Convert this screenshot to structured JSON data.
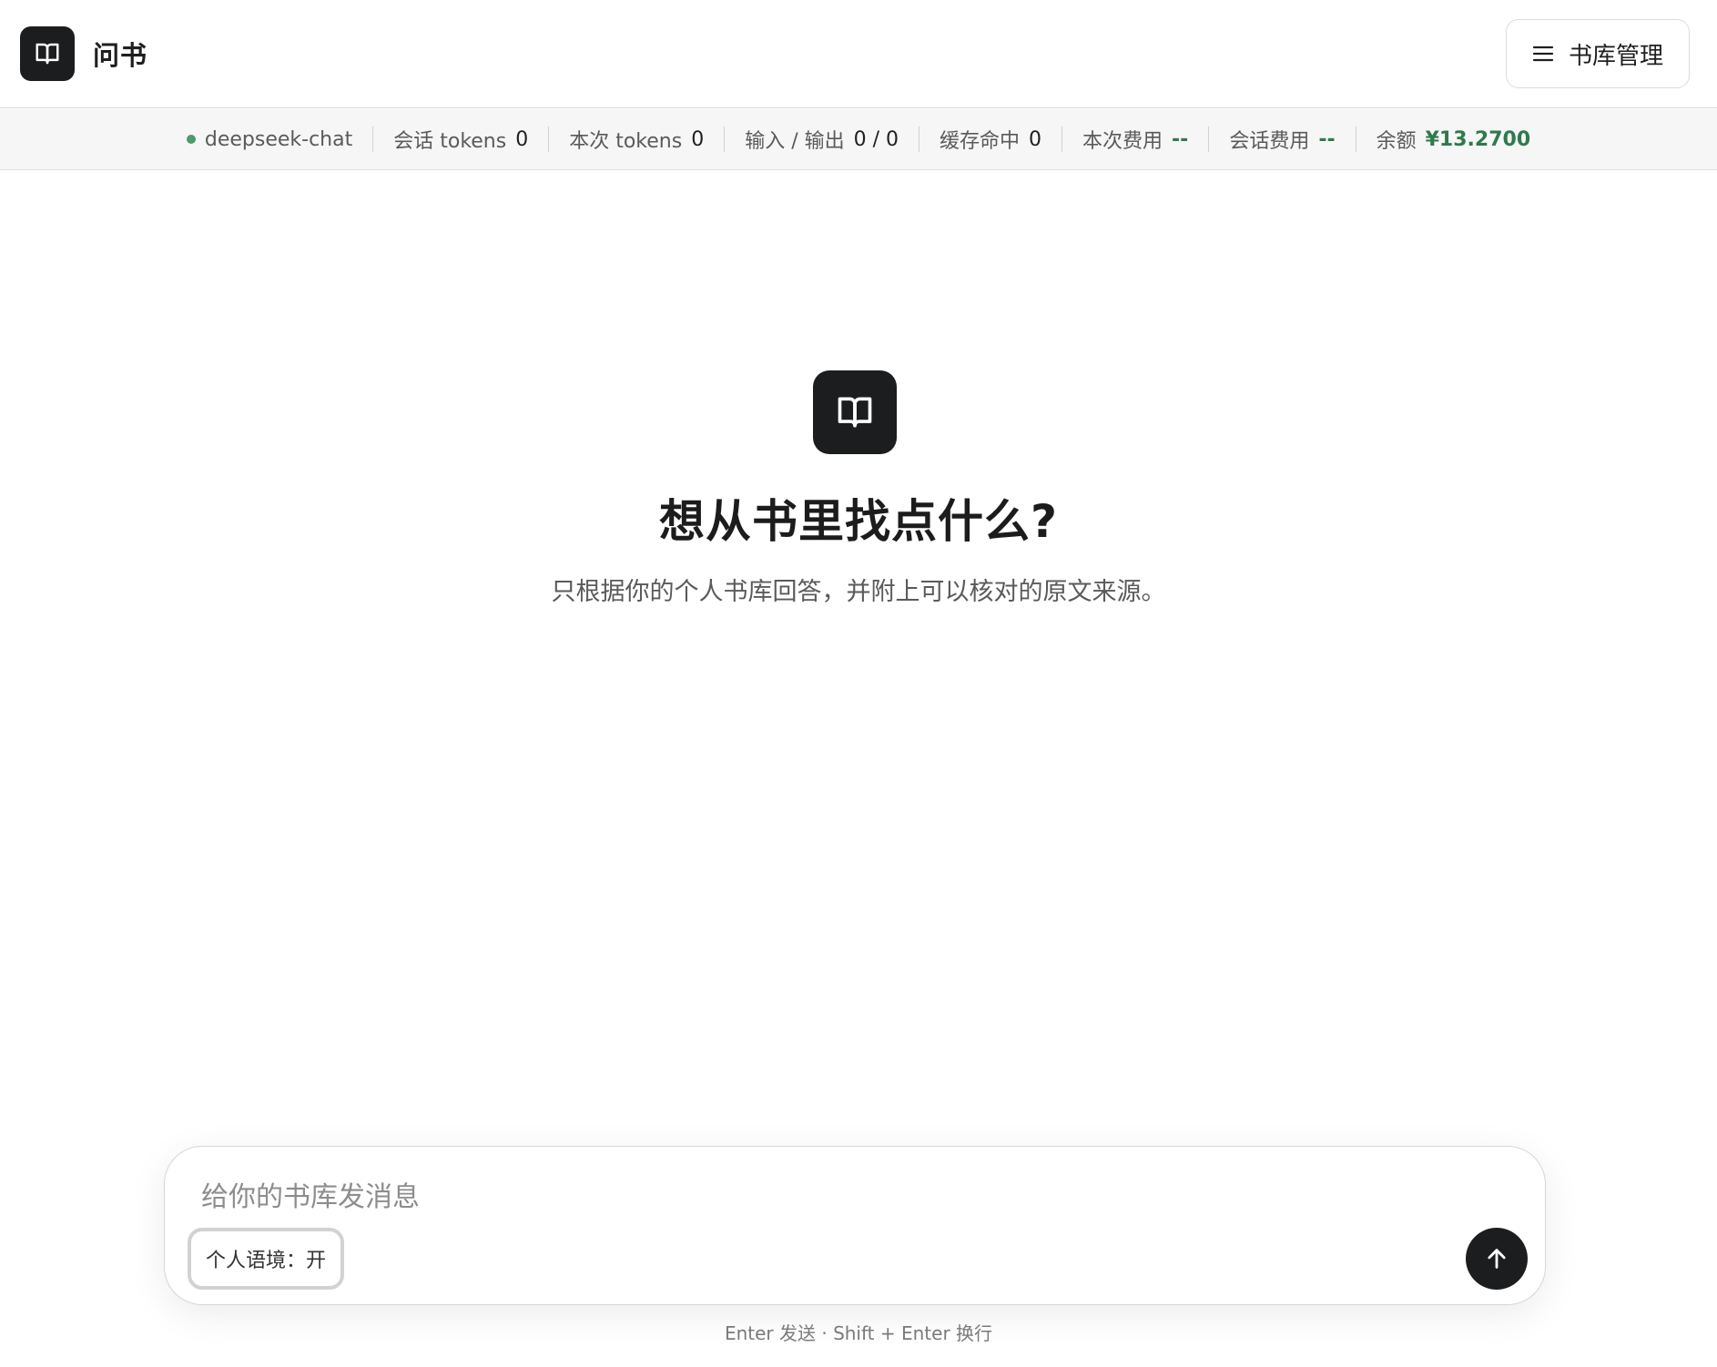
{
  "app": {
    "title": "问书",
    "logo_icon": "book-open-icon"
  },
  "header": {
    "library_button_label": "书库管理",
    "library_button_icon": "menu-icon"
  },
  "status": {
    "model": "deepseek-chat",
    "model_status_color": "#4d9a6a",
    "items": [
      {
        "label": "会话 tokens",
        "value": "0"
      },
      {
        "label": "本次 tokens",
        "value": "0"
      },
      {
        "label": "输入 / 输出",
        "value": "0 / 0"
      },
      {
        "label": "缓存命中",
        "value": "0"
      },
      {
        "label": "本次费用",
        "value": "--"
      },
      {
        "label": "会话费用",
        "value": "--"
      },
      {
        "label": "余额",
        "value": "¥13.2700"
      }
    ],
    "accent_color": "#2f7a4c"
  },
  "hero": {
    "icon": "book-open-icon",
    "title": "想从书里找点什么?",
    "subtitle": "只根据你的个人书库回答，并附上可以核对的原文来源。"
  },
  "composer": {
    "placeholder": "给你的书库发消息",
    "value": "",
    "context_toggle_label": "个人语境：开",
    "send_icon": "arrow-up-icon"
  },
  "footer": {
    "hint": "Enter 发送 · Shift + Enter 换行"
  }
}
